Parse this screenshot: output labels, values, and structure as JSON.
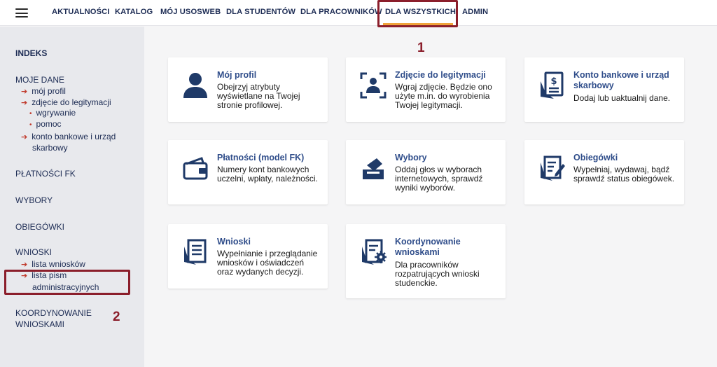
{
  "nav": {
    "items": [
      "AKTUALNOŚCI",
      "KATALOG",
      "MÓJ USOSWEB",
      "DLA STUDENTÓW",
      "DLA PRACOWNIKÓW",
      "DLA WSZYSTKICH",
      "ADMIN"
    ],
    "active": "DLA WSZYSTKICH"
  },
  "annotations": {
    "one": "1",
    "two": "2"
  },
  "sidebar": {
    "indeks": "INDEKS",
    "moje_dane": "MOJE DANE",
    "moj_profil": "mój profil",
    "zdjecie": "zdjęcie do legitymacji",
    "wgrywanie": "wgrywanie",
    "pomoc": "pomoc",
    "konto_1": "konto bankowe i urząd",
    "konto_2": "skarbowy",
    "platnosci": "PŁATNOŚCI FK",
    "wybory": "WYBORY",
    "obiegowki": "OBIEGÓWKI",
    "wnioski": "WNIOSKI",
    "lista_wnioskow": "lista wniosków",
    "lista_pism_1": "lista pism",
    "lista_pism_2": "administracyjnych",
    "koordynowanie_1": "KOORDYNOWANIE",
    "koordynowanie_2": "WNIOSKAMI"
  },
  "cards": [
    {
      "title": "Mój profil",
      "desc": "Obejrzyj atrybuty wyświetlane na Twojej stronie profilowej.",
      "icon": "person-icon"
    },
    {
      "title": "Zdjęcie do legitymacji",
      "desc": "Wgraj zdjęcie. Będzie ono użyte m.in. do wyrobienia Twojej legitymacji.",
      "icon": "photo-frame-icon"
    },
    {
      "title": "Konto bankowe i urząd skarbowy",
      "desc": "Dodaj lub uaktualnij dane.",
      "icon": "dollar-document-icon"
    },
    {
      "title": "Płatności (model FK)",
      "desc": "Numery kont bankowych uczelni, wpłaty, należności.",
      "icon": "wallet-icon"
    },
    {
      "title": "Wybory",
      "desc": "Oddaj głos w wyborach internetowych, sprawdź wyniki wyborów.",
      "icon": "ballot-box-icon"
    },
    {
      "title": "Obiegówki",
      "desc": "Wypełniaj, wydawaj, bądź sprawdź status obiegówek.",
      "icon": "document-edit-icon"
    },
    {
      "title": "Wnioski",
      "desc": "Wypełnianie i przeglądanie wniosków i oświadczeń oraz wydanych decyzji.",
      "icon": "documents-icon"
    },
    {
      "title": "Koordynowanie wnioskami",
      "desc": "Dla pracowników rozpatrujących wnioski studenckie.",
      "icon": "document-gear-icon"
    }
  ],
  "colors": {
    "accent": "#f0a33a",
    "annotation": "#8b1e2b",
    "icon": "#1f3a68",
    "link": "#2f4d8a"
  }
}
